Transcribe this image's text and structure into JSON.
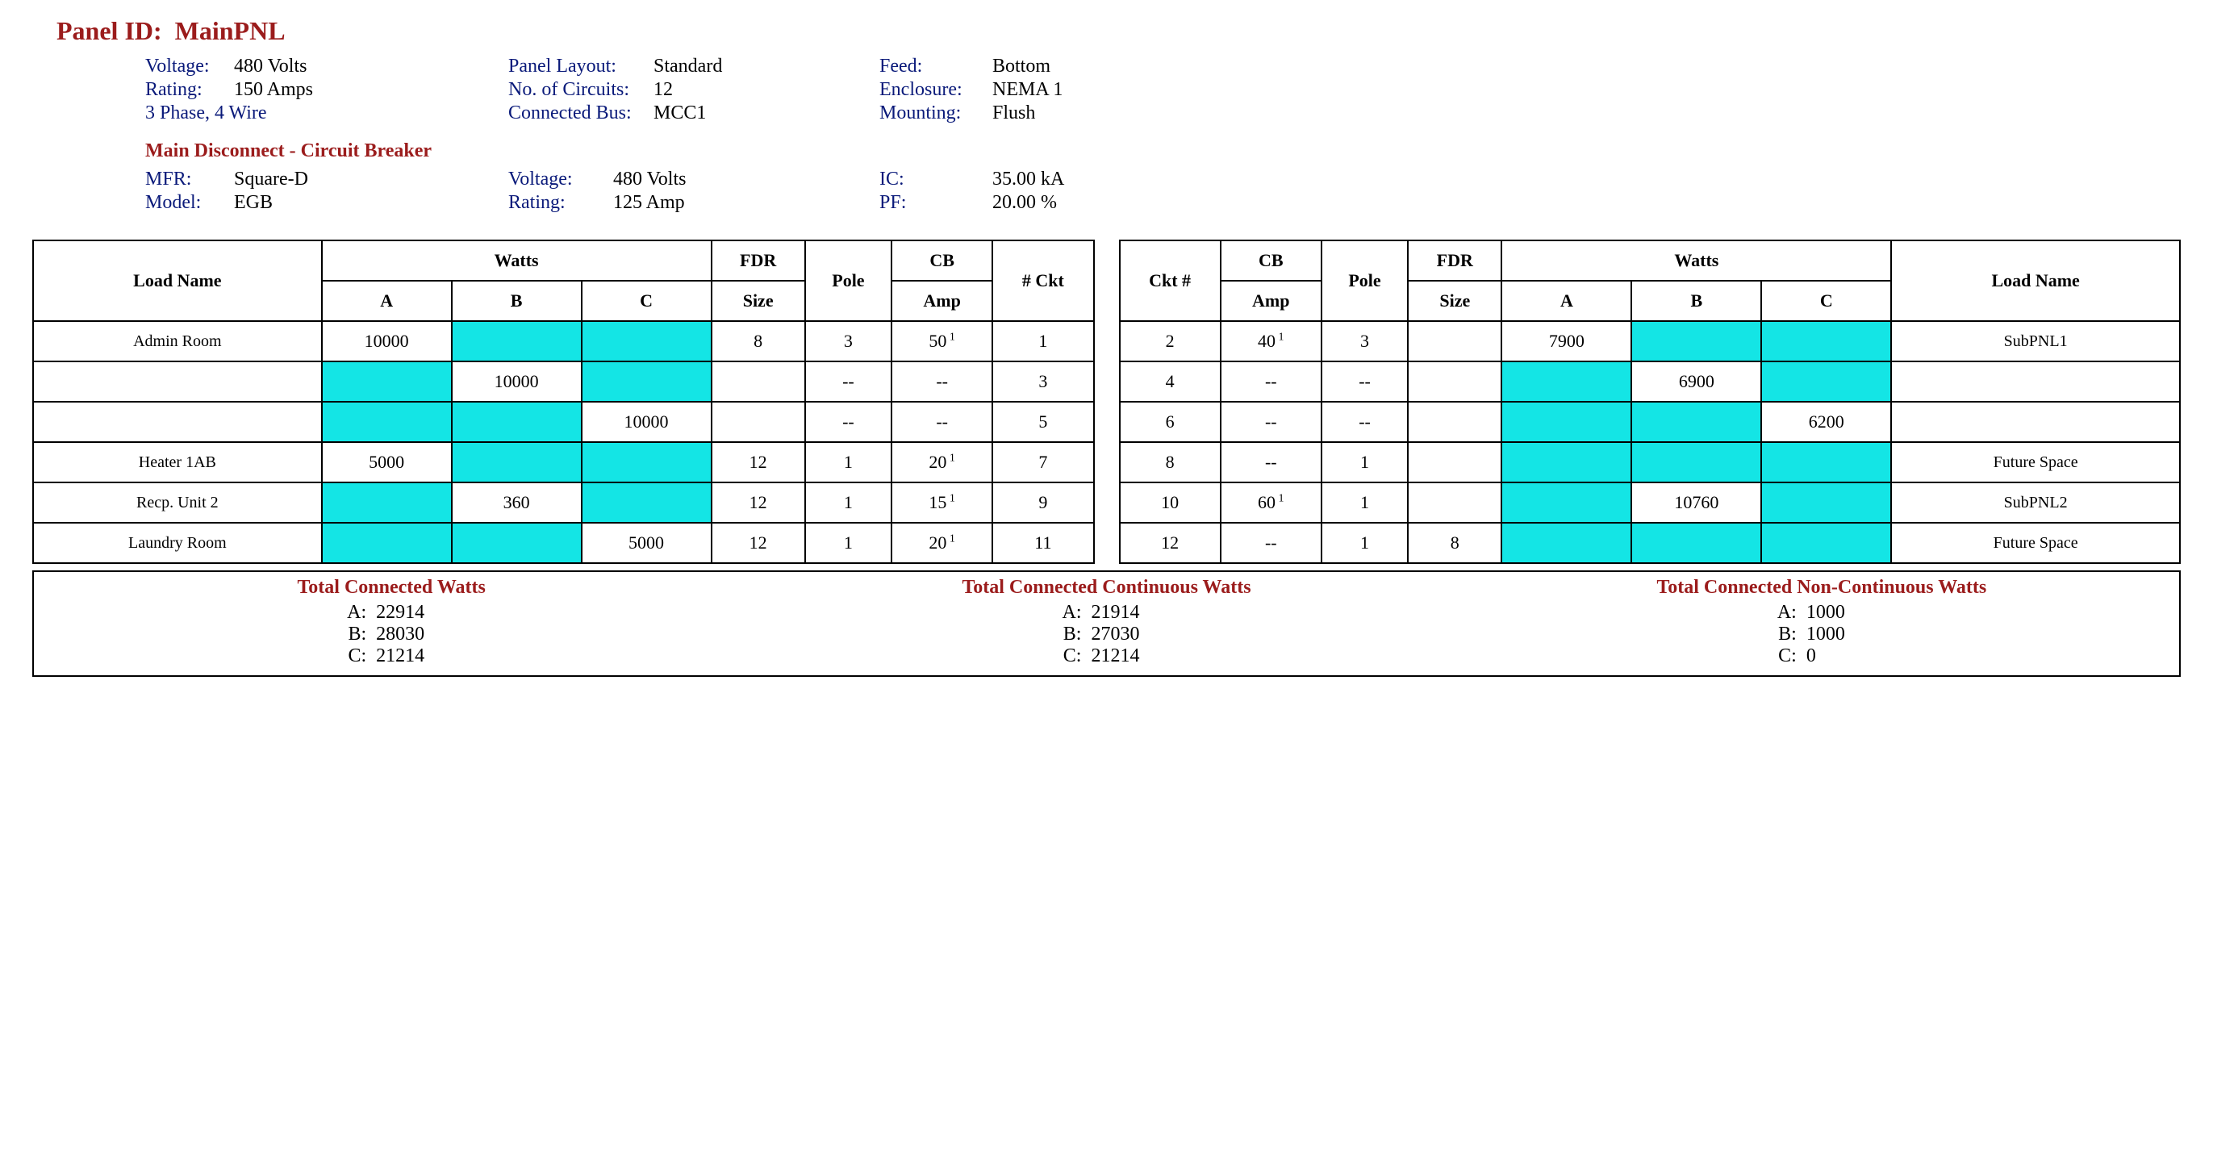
{
  "title_label": "Panel ID:",
  "title_value": "MainPNL",
  "info": {
    "voltage_label": "Voltage:",
    "voltage_value": "480 Volts",
    "rating_label": "Rating:",
    "rating_value": "150 Amps",
    "phase_wire": "3 Phase, 4 Wire",
    "panel_layout_label": "Panel Layout:",
    "panel_layout_value": "Standard",
    "circuits_label": "No. of Circuits:",
    "circuits_value": "12",
    "bus_label": "Connected Bus:",
    "bus_value": "MCC1",
    "feed_label": "Feed:",
    "feed_value": "Bottom",
    "enclosure_label": "Enclosure:",
    "enclosure_value": "NEMA 1",
    "mounting_label": "Mounting:",
    "mounting_value": "Flush"
  },
  "disconnect_heading": "Main Disconnect - Circuit Breaker",
  "disc": {
    "mfr_label": "MFR:",
    "mfr_value": "Square-D",
    "model_label": "Model:",
    "model_value": "EGB",
    "voltage_label": "Voltage:",
    "voltage_value": "480 Volts",
    "rating_label": "Rating:",
    "rating_value": "125 Amp",
    "ic_label": "IC:",
    "ic_value": "35.00 kA",
    "pf_label": "PF:",
    "pf_value": "20.00 %"
  },
  "headers": {
    "load_name": "Load Name",
    "watts": "Watts",
    "a": "A",
    "b": "B",
    "c": "C",
    "fdr_size": "FDR",
    "size": "Size",
    "pole": "Pole",
    "cb": "CB",
    "amp": "Amp",
    "ckt_num": "# Ckt",
    "ckt_num2": "Ckt #"
  },
  "left_rows": [
    {
      "load": "Admin Room",
      "a": "10000",
      "b": "",
      "c": "",
      "a_c": true,
      "b_c": true,
      "c_c": true,
      "fdr": "8",
      "pole": "3",
      "cb": "50",
      "sup": "1",
      "ckt": "1"
    },
    {
      "load": "",
      "a": "",
      "b": "10000",
      "c": "",
      "a_c": true,
      "b_c": false,
      "c_c": true,
      "fdr": "",
      "pole": "--",
      "cb": "--",
      "sup": "",
      "ckt": "3"
    },
    {
      "load": "",
      "a": "",
      "b": "",
      "c": "10000",
      "a_c": true,
      "b_c": true,
      "c_c": false,
      "fdr": "",
      "pole": "--",
      "cb": "--",
      "sup": "",
      "ckt": "5"
    },
    {
      "load": "Heater 1AB",
      "a": "5000",
      "b": "",
      "c": "",
      "a_c": false,
      "b_c": true,
      "c_c": true,
      "fdr": "12",
      "pole": "1",
      "cb": "20",
      "sup": "1",
      "ckt": "7"
    },
    {
      "load": "Recp. Unit 2",
      "a": "",
      "b": "360",
      "c": "",
      "a_c": true,
      "b_c": false,
      "c_c": true,
      "fdr": "12",
      "pole": "1",
      "cb": "15",
      "sup": "1",
      "ckt": "9"
    },
    {
      "load": "Laundry Room",
      "a": "",
      "b": "",
      "c": "5000",
      "a_c": true,
      "b_c": true,
      "c_c": false,
      "fdr": "12",
      "pole": "1",
      "cb": "20",
      "sup": "1",
      "ckt": "11"
    }
  ],
  "right_rows": [
    {
      "ckt": "2",
      "cb": "40",
      "sup": "1",
      "pole": "3",
      "fdr": "",
      "a": "7900",
      "b": "",
      "c": "",
      "a_c": false,
      "b_c": true,
      "c_c": true,
      "load": "SubPNL1"
    },
    {
      "ckt": "4",
      "cb": "--",
      "sup": "",
      "pole": "--",
      "fdr": "",
      "a": "",
      "b": "6900",
      "c": "",
      "a_c": true,
      "b_c": false,
      "c_c": true,
      "load": ""
    },
    {
      "ckt": "6",
      "cb": "--",
      "sup": "",
      "pole": "--",
      "fdr": "",
      "a": "",
      "b": "",
      "c": "6200",
      "a_c": true,
      "b_c": true,
      "c_c": false,
      "load": ""
    },
    {
      "ckt": "8",
      "cb": "--",
      "sup": "",
      "pole": "1",
      "fdr": "",
      "a": "",
      "b": "",
      "c": "",
      "a_c": true,
      "b_c": true,
      "c_c": true,
      "load": "Future Space"
    },
    {
      "ckt": "10",
      "cb": "60",
      "sup": "1",
      "pole": "1",
      "fdr": "",
      "a": "",
      "b": "10760",
      "c": "",
      "a_c": true,
      "b_c": false,
      "c_c": true,
      "load": "SubPNL2"
    },
    {
      "ckt": "12",
      "cb": "--",
      "sup": "",
      "pole": "1",
      "fdr": "8",
      "a": "",
      "b": "",
      "c": "",
      "a_c": true,
      "b_c": true,
      "c_c": true,
      "load": "Future Space"
    }
  ],
  "totals": {
    "connected": {
      "title": "Total Connected Watts",
      "a": "22914",
      "b": "28030",
      "c": "21214"
    },
    "continuous": {
      "title": "Total Connected Continuous Watts",
      "a": "21914",
      "b": "27030",
      "c": "21214"
    },
    "noncont": {
      "title": "Total Connected Non-Continuous Watts",
      "a": "1000",
      "b": "1000",
      "c": "0"
    }
  },
  "labels": {
    "a": "A:",
    "b": "B:",
    "c": "C:"
  }
}
